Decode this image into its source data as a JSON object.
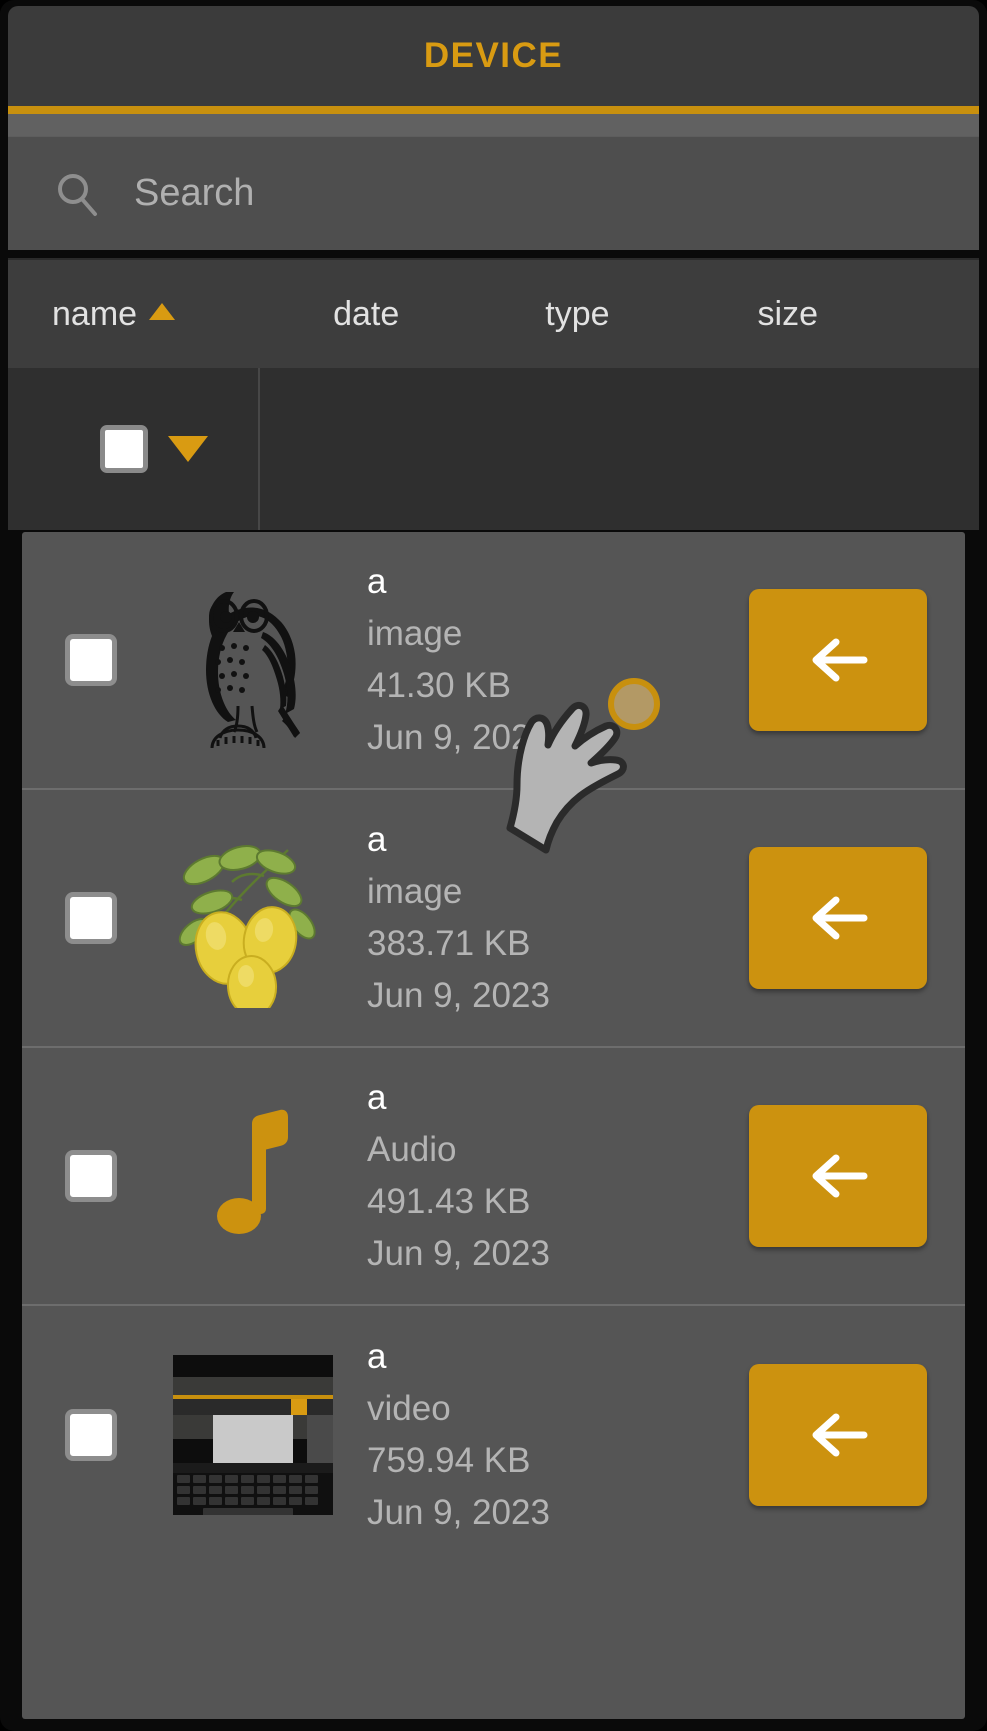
{
  "window": {
    "title": "DEVICE",
    "accent_color": "#c8900e",
    "title_color": "#d99b12",
    "titlebar_bg": "#3b3b3b",
    "row_bg": "#555555",
    "button_color": "#cc920f"
  },
  "search": {
    "placeholder": "Search",
    "value": "",
    "icon": "search-icon"
  },
  "columns": [
    {
      "label": "name",
      "sorted": true,
      "sort_direction": "asc",
      "sort_icon": "triangle-up-icon"
    },
    {
      "label": "date",
      "sorted": false
    },
    {
      "label": "type",
      "sorted": false
    },
    {
      "label": "size",
      "sorted": false
    }
  ],
  "select_all": {
    "checkbox_checked": false,
    "checkbox_icon": "checkbox-icon",
    "dropdown_icon": "chevron-down-icon"
  },
  "files": [
    {
      "name": "a",
      "type": "image",
      "size": "41.30 KB",
      "date": "Jun 9, 2023",
      "thumbnail": "owl-illustration-thumbnail",
      "checkbox_checked": false,
      "action_icon": "arrow-left-icon"
    },
    {
      "name": "a",
      "type": "image",
      "size": "383.71 KB",
      "date": "Jun 9, 2023",
      "thumbnail": "lemons-watercolor-thumbnail",
      "checkbox_checked": false,
      "action_icon": "arrow-left-icon"
    },
    {
      "name": "a",
      "type": "Audio",
      "size": "491.43 KB",
      "date": "Jun 9, 2023",
      "thumbnail": "music-note-icon",
      "checkbox_checked": false,
      "action_icon": "arrow-left-icon"
    },
    {
      "name": "a",
      "type": "video",
      "size": "759.94 KB",
      "date": "Jun 9, 2023",
      "thumbnail": "video-screenshot-thumbnail",
      "checkbox_checked": false,
      "action_icon": "arrow-left-icon"
    }
  ],
  "cursor": {
    "icon": "touch-pointer-hand-icon",
    "tap_indicator": "tap-ripple-icon"
  }
}
